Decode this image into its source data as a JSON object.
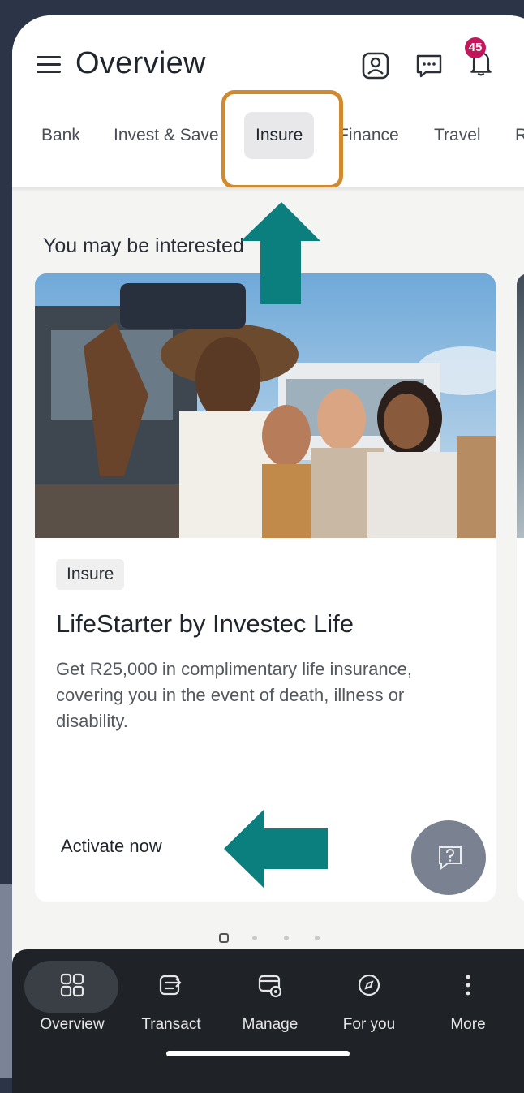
{
  "header": {
    "title": "Overview",
    "notification_count": "45"
  },
  "tabs": [
    {
      "label": "Bank"
    },
    {
      "label": "Invest & Save"
    },
    {
      "label": "Insure",
      "active": true
    },
    {
      "label": "Finance"
    },
    {
      "label": "Travel"
    },
    {
      "label": "R"
    }
  ],
  "section": {
    "title": "You may be interested"
  },
  "card": {
    "tag": "Insure",
    "title": "LifeStarter by Investec Life",
    "description": "Get R25,000 in complimentary life insurance, covering you in the event of death, illness or disability.",
    "cta": "Activate now"
  },
  "carousel": {
    "pages": 4,
    "current": 1
  },
  "nav": [
    {
      "label": "Overview",
      "icon": "grid-icon",
      "active": true
    },
    {
      "label": "Transact",
      "icon": "transfer-icon"
    },
    {
      "label": "Manage",
      "icon": "card-settings-icon"
    },
    {
      "label": "For you",
      "icon": "compass-icon"
    },
    {
      "label": "More",
      "icon": "more-vertical-icon"
    }
  ],
  "colors": {
    "highlight": "#d18b2e",
    "arrow": "#0b7f7d",
    "badge": "#c2185b",
    "navbar": "#1f2227"
  }
}
